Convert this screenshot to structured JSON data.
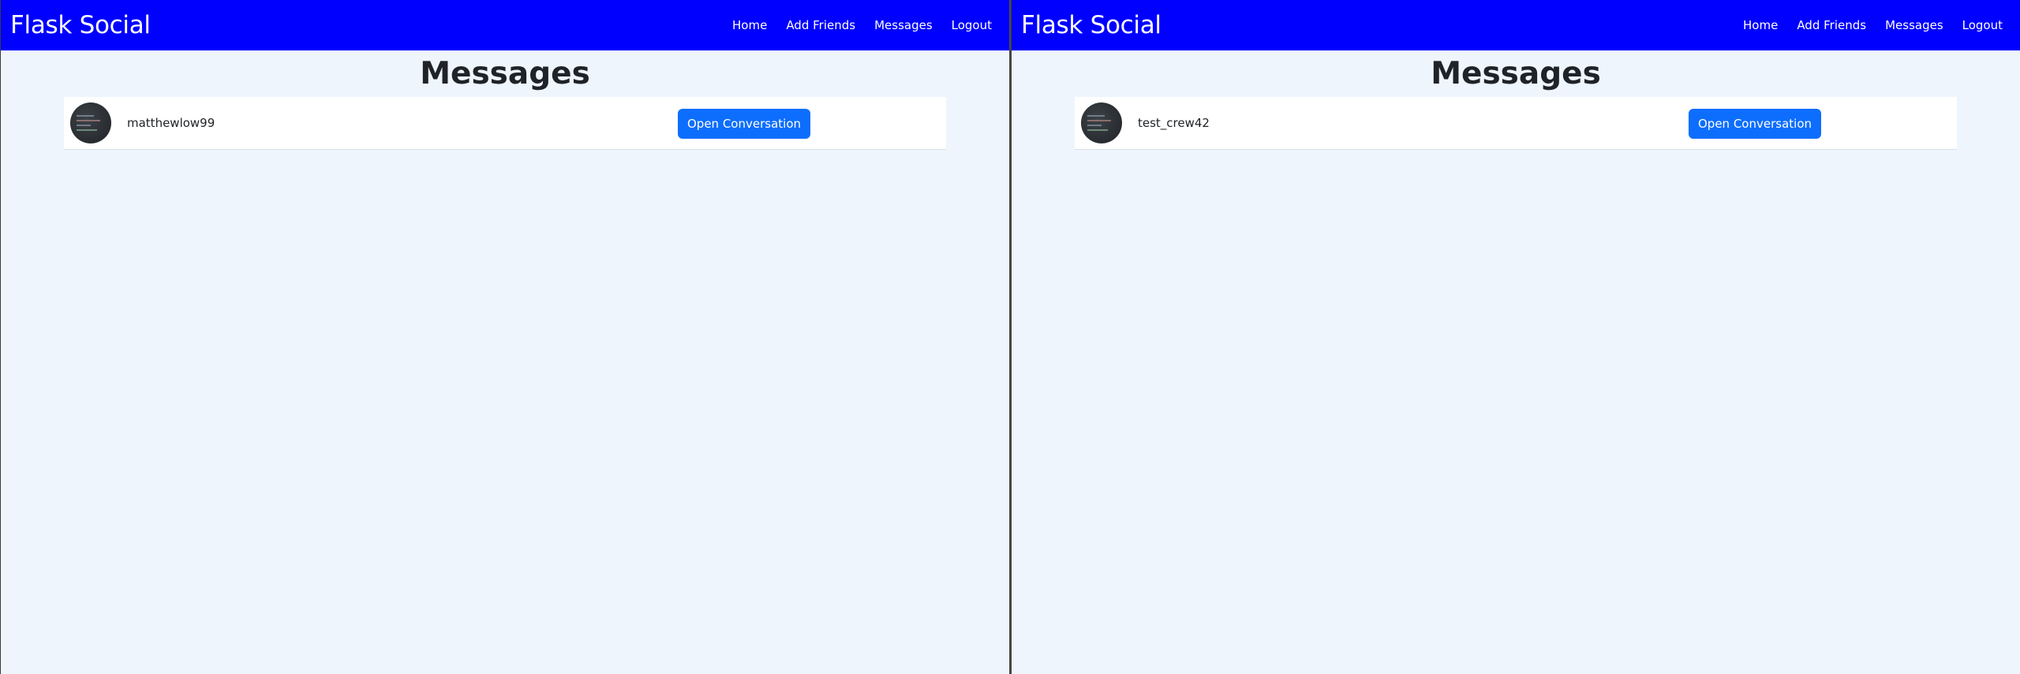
{
  "windows": [
    {
      "brand": "Flask Social",
      "nav": [
        "Home",
        "Add Friends",
        "Messages",
        "Logout"
      ],
      "page_title": "Messages",
      "conversations": [
        {
          "username": "matthewlow99",
          "button_label": "Open Conversation"
        }
      ]
    },
    {
      "brand": "Flask Social",
      "nav": [
        "Home",
        "Add Friends",
        "Messages",
        "Logout"
      ],
      "page_title": "Messages",
      "conversations": [
        {
          "username": "test_crew42",
          "button_label": "Open Conversation"
        }
      ]
    }
  ],
  "colors": {
    "navbar": "#0000ff",
    "page_background": "#eef5fd",
    "button": "#0d6efd"
  }
}
